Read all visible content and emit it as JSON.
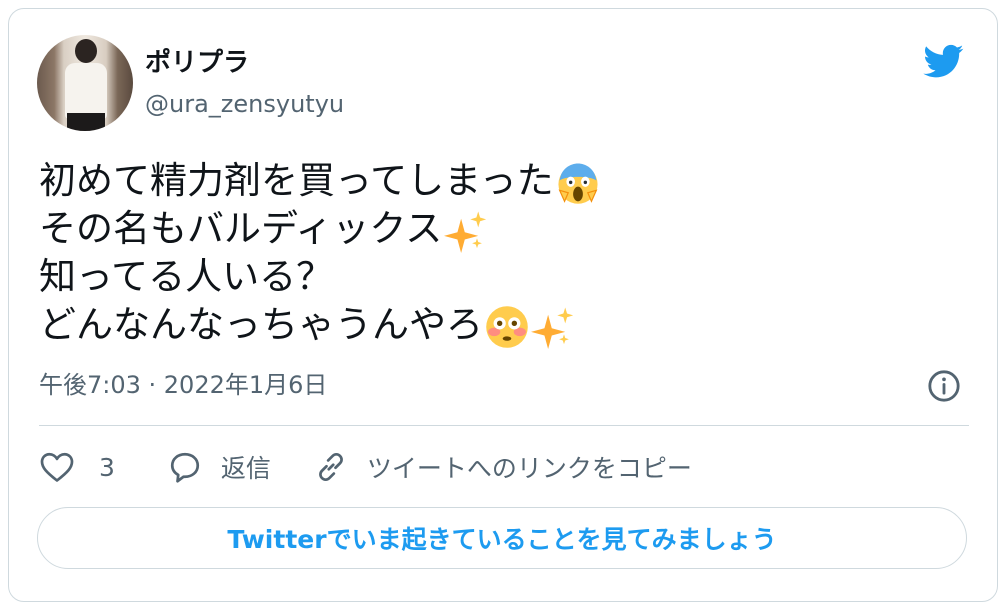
{
  "author": {
    "display_name": "ポリプラ",
    "handle": "@ura_zensyutyu"
  },
  "tweet": {
    "lines": [
      "初めて精力剤を買ってしまった",
      "その名もバルディックス",
      "知ってる人いる？",
      "どんなんなっちゃうんやろ"
    ],
    "emojis": [
      "screaming-face-emoji",
      "sparkles-emoji",
      "flushed-face-emoji",
      "sparkles-emoji"
    ]
  },
  "meta": {
    "timestamp": "午後7:03 · 2022年1月6日"
  },
  "actions": {
    "like_count": "3",
    "reply_label": "返信",
    "copy_link_label": "ツイートへのリンクをコピー"
  },
  "cta": {
    "label": "Twitterでいま起きていることを見てみましょう"
  },
  "colors": {
    "brand_blue": "#1d9bf0",
    "secondary_text": "#536471",
    "border": "#cfd9de"
  }
}
